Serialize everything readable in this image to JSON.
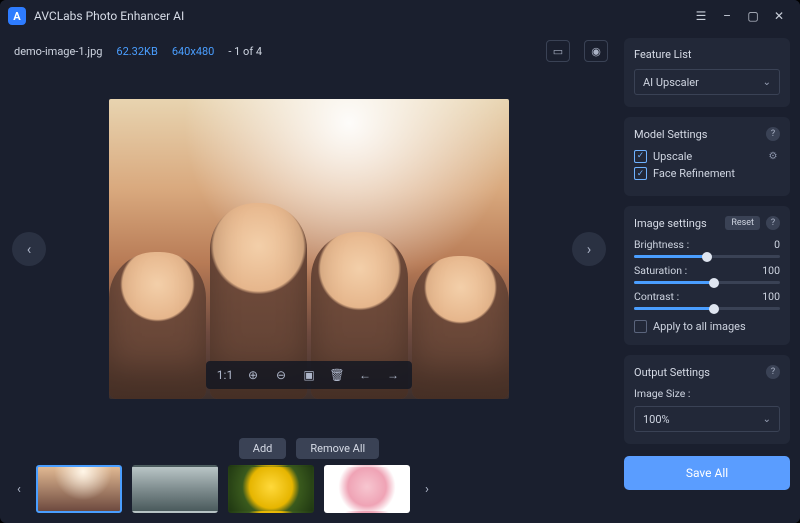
{
  "titlebar": {
    "app_name": "AVCLabs Photo Enhancer AI",
    "icons": {
      "menu": "☰",
      "minimize": "–",
      "maximize": "▢",
      "close": "✕"
    }
  },
  "info": {
    "filename": "demo-image-1.jpg",
    "filesize": "62.32KB",
    "dimensions": "640x480",
    "counter": "- 1 of 4",
    "crop_icon": "▭",
    "eye_icon": "◉"
  },
  "preview": {
    "tools": {
      "one_to_one": "1:1",
      "zoom_in": "⊕",
      "zoom_out": "⊖",
      "fit": "▣",
      "delete": "🗑",
      "prev": "←",
      "next": "→"
    },
    "nav_prev": "‹",
    "nav_next": "›"
  },
  "actions": {
    "add": "Add",
    "remove_all": "Remove All"
  },
  "thumbs": {
    "nav_prev": "‹",
    "nav_next": "›"
  },
  "sidebar": {
    "feature_list": {
      "title": "Feature List",
      "selected": "AI Upscaler"
    },
    "model_settings": {
      "title": "Model Settings",
      "upscale": {
        "label": "Upscale",
        "checked": true
      },
      "face": {
        "label": "Face Refinement",
        "checked": true
      }
    },
    "image_settings": {
      "title": "Image settings",
      "reset": "Reset",
      "brightness": {
        "label": "Brightness :",
        "value": "0",
        "pct": 50
      },
      "saturation": {
        "label": "Saturation :",
        "value": "100",
        "pct": 55
      },
      "contrast": {
        "label": "Contrast :",
        "value": "100",
        "pct": 55
      },
      "apply_all": "Apply to all images"
    },
    "output": {
      "title": "Output Settings",
      "image_size_label": "Image Size :",
      "image_size_value": "100%"
    },
    "save_all": "Save All",
    "help": "?"
  }
}
